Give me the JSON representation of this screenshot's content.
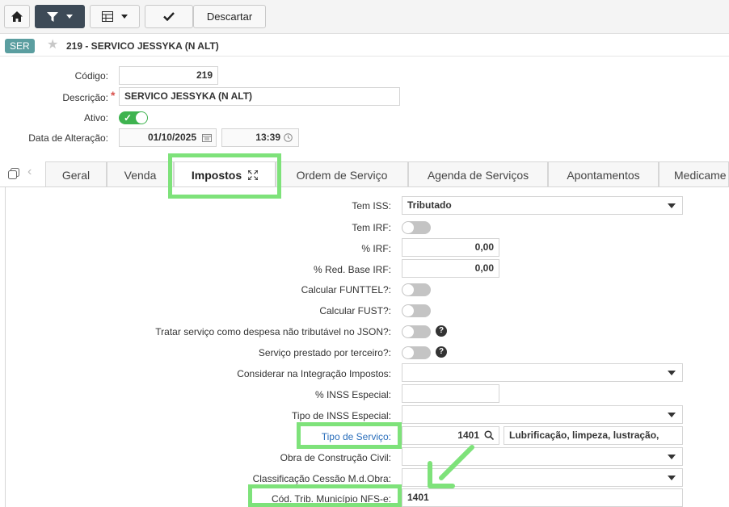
{
  "toolbar": {
    "home_icon": "home-icon",
    "filter_icon": "filter-icon",
    "grid_icon": "grid-icon",
    "save_icon": "check-icon",
    "discard_label": "Descartar"
  },
  "header": {
    "badge": "SER",
    "title": "219 - SERVICO JESSYKA (N ALT)"
  },
  "form": {
    "codigo_label": "Código:",
    "codigo_value": "219",
    "descricao_label": "Descrição:",
    "descricao_required": "*",
    "descricao_value": "SERVICO JESSYKA (N ALT)",
    "ativo_label": "Ativo:",
    "ativo_on": true,
    "data_alt_label": "Data de Alteração:",
    "data_value": "01/10/2025",
    "hora_value": "13:39"
  },
  "tabs": [
    {
      "label": "Geral"
    },
    {
      "label": "Venda"
    },
    {
      "label": "Impostos"
    },
    {
      "label": "Ordem de Serviço"
    },
    {
      "label": "Agenda de Serviços"
    },
    {
      "label": "Apontamentos"
    },
    {
      "label": "Medicame"
    }
  ],
  "impostos": {
    "tem_iss_label": "Tem ISS:",
    "tem_iss_value": "Tributado",
    "tem_irf_label": "Tem IRF:",
    "pct_irf_label": "% IRF:",
    "pct_irf_value": "0,00",
    "red_base_label": "% Red. Base IRF:",
    "red_base_value": "0,00",
    "funttel_label": "Calcular FUNTTEL?:",
    "fust_label": "Calcular FUST?:",
    "tratar_label": "Tratar serviço como despesa não tributável no JSON?:",
    "terceiro_label": "Serviço prestado por terceiro?:",
    "considerar_label": "Considerar na Integração Impostos:",
    "considerar_value": "",
    "inss_esp_label": "% INSS Especial:",
    "inss_esp_value": "",
    "tipo_inss_label": "Tipo de INSS Especial:",
    "tipo_inss_value": "",
    "tipo_servico_label": "Tipo de Serviço:",
    "tipo_servico_code": "1401",
    "tipo_servico_desc": "Lubrificação, limpeza, lustração,",
    "obra_label": "Obra de Construção Civil:",
    "obra_value": "",
    "cessao_label": "Classificação Cessão M.d.Obra:",
    "cessao_value": "",
    "cod_trib_label": "Cód. Trib. Município NFS-e:",
    "cod_trib_value": "1401"
  },
  "colors": {
    "highlight": "#7ee27a",
    "toggle_on": "#3eb34f",
    "badge": "#5b9ea0"
  }
}
